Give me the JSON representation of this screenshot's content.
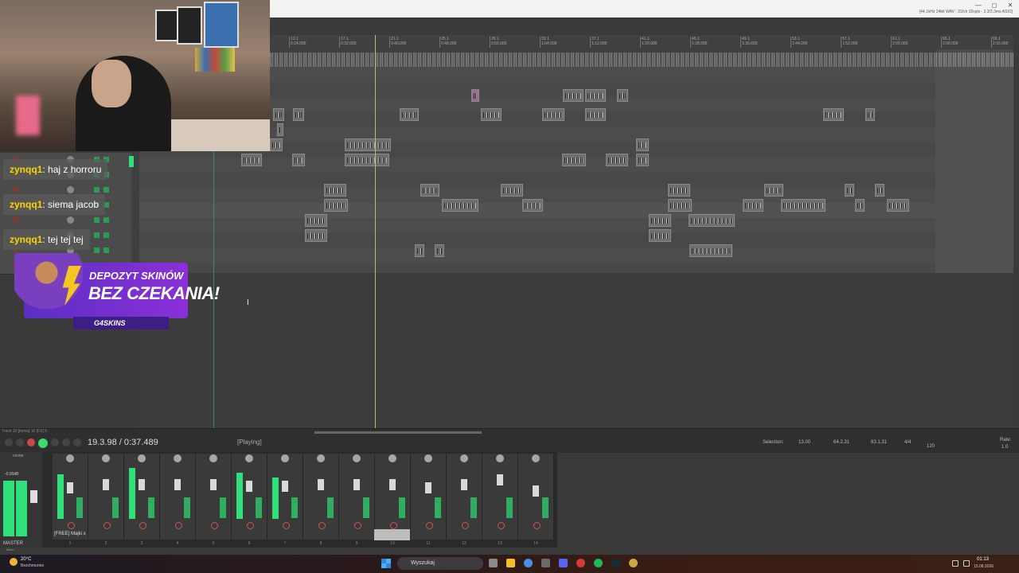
{
  "daw": {
    "format_info": "[44.1kHz 24bit WAV : 2/2ch 32spls - 2.3/3.3ms ASIO]",
    "window_controls": [
      "—",
      "◻",
      "✕"
    ],
    "ruler_marks": [
      {
        "bar": "13.1",
        "time": "0:24.000"
      },
      {
        "bar": "17.1",
        "time": "0:32.000"
      },
      {
        "bar": "21.1",
        "time": "0:40.000"
      },
      {
        "bar": "25.1",
        "time": "0:48.000"
      },
      {
        "bar": "29.1",
        "time": "0:56.000"
      },
      {
        "bar": "33.1",
        "time": "1:04.000"
      },
      {
        "bar": "37.1",
        "time": "1:12.000"
      },
      {
        "bar": "41.1",
        "time": "1:20.000"
      },
      {
        "bar": "45.1",
        "time": "1:28.000"
      },
      {
        "bar": "49.1",
        "time": "1:36.000"
      },
      {
        "bar": "53.1",
        "time": "1:44.000"
      },
      {
        "bar": "57.1",
        "time": "1:52.000"
      },
      {
        "bar": "61.1",
        "time": "2:00.000"
      },
      {
        "bar": "65.1",
        "time": "2:08.000"
      },
      {
        "bar": "69.1",
        "time": "2:16.000"
      }
    ],
    "track_status": "Track 10 [items] 10 [FX] 5",
    "transport": {
      "time": "19.3.98 / 0:37.489",
      "state": "[Playing]",
      "selection_label": "Selection:",
      "selection_start": "13.00",
      "selection_end": "64.2.31",
      "selection_length": "63.1.31",
      "time_signature": "4/4",
      "tempo": "120",
      "rate_label": "Rate:",
      "rate_value": "1.0"
    },
    "mixer": {
      "center_label": "center",
      "master_db": "-0.00dB",
      "master_label": "MASTER",
      "mixer_tab": "Mixer",
      "selected_track_name": "[FREE] Majki x",
      "strip_numbers": [
        "1",
        "2",
        "3",
        "4",
        "5",
        "6",
        "7",
        "8",
        "9",
        "10",
        "11",
        "12",
        "13",
        "14"
      ]
    }
  },
  "chat": {
    "messages": [
      {
        "user": "zynqq1",
        "text": "haj z horroru"
      },
      {
        "user": "zynqq1",
        "text": "siema jacob"
      },
      {
        "user": "zynqq1",
        "text": "tej tej tej"
      }
    ]
  },
  "ad": {
    "line1": "DEPOZYT SKINÓW",
    "line2": "BEZ CZEKANIA!",
    "brand": "G4SKINS"
  },
  "taskbar": {
    "weather_temp": "20°C",
    "weather_desc": "Bezchmurnie",
    "search_placeholder": "Wyszukaj",
    "clock_time": "01:13",
    "clock_date": "15.08.2026"
  }
}
